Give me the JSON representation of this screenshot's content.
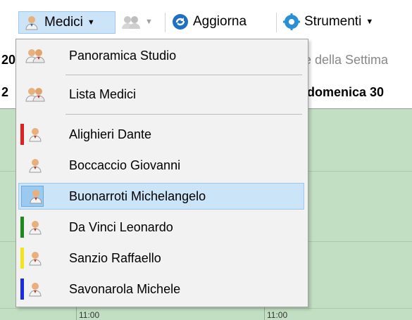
{
  "toolbar": {
    "medici_label": "Medici",
    "aggiorna_label": "Aggiorna",
    "strumenti_label": "Strumenti"
  },
  "calendar": {
    "row1_left": "20",
    "row1_header_partial": "e della Settima",
    "row2_left": "2",
    "row2_day": "domenica 30",
    "time_1": "11:00",
    "time_2": "11:00"
  },
  "menu": {
    "items": [
      {
        "label": "Panoramica Studio"
      },
      {
        "label": "Lista Medici"
      },
      {
        "label": "Alighieri Dante",
        "color": "#e02020"
      },
      {
        "label": "Boccaccio Giovanni",
        "color": ""
      },
      {
        "label": "Buonarroti Michelangelo",
        "color": "#2b78e4"
      },
      {
        "label": "Da Vinci Leonardo",
        "color": "#1e8a1e"
      },
      {
        "label": "Sanzio Raffaello",
        "color": "#f2e51c"
      },
      {
        "label": "Savonarola Michele",
        "color": "#1a2be0"
      }
    ]
  }
}
